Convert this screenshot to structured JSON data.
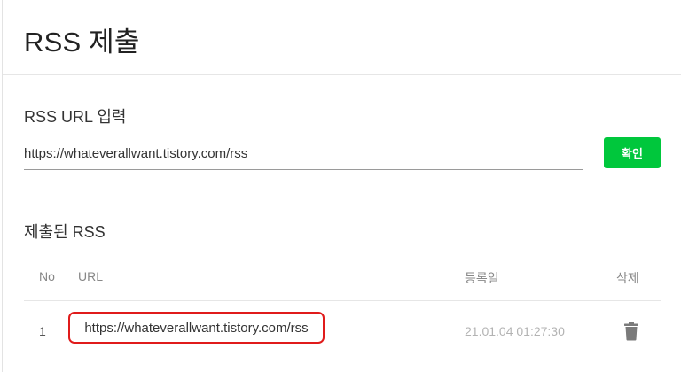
{
  "page": {
    "title": "RSS 제출"
  },
  "input_section": {
    "label": "RSS URL 입력",
    "url_value": "https://whateverallwant.tistory.com/rss",
    "confirm_label": "확인",
    "accent_color": "#00c73c"
  },
  "submitted": {
    "label": "제출된 RSS",
    "columns": {
      "no": "No",
      "url": "URL",
      "date": "등록일",
      "delete": "삭제"
    },
    "rows": [
      {
        "no": "1",
        "url": "https://whateverallwant.tistory.com/rss",
        "date": "21.01.04 01:27:30",
        "delete_icon": "trash-icon"
      }
    ],
    "highlight_color": "#e01b1b"
  }
}
